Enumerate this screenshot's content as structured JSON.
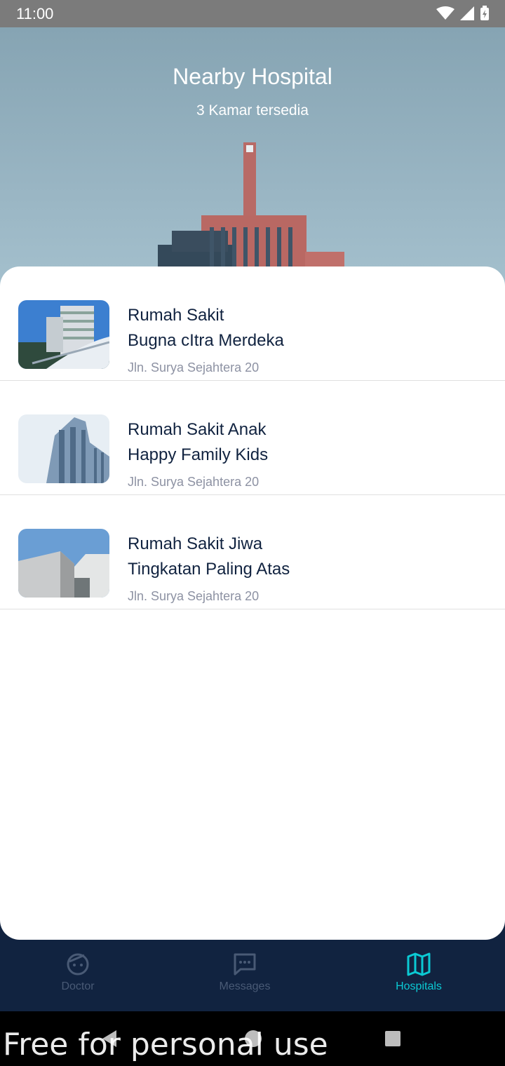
{
  "status_bar": {
    "time": "11:00"
  },
  "header": {
    "title": "Nearby Hospital",
    "subtitle": "3 Kamar tersedia"
  },
  "hospitals": [
    {
      "name": "Rumah Sakit\nBugna cItra Merdeka",
      "address": "Jln. Surya Sejahtera 20"
    },
    {
      "name": "Rumah Sakit Anak\nHappy Family Kids",
      "address": "Jln. Surya Sejahtera 20"
    },
    {
      "name": "Rumah Sakit Jiwa\nTingkatan Paling Atas",
      "address": "Jln. Surya Sejahtera 20"
    }
  ],
  "bottom_nav": {
    "items": [
      {
        "label": "Doctor",
        "icon": "doctor-face-icon",
        "active": false
      },
      {
        "label": "Messages",
        "icon": "message-icon",
        "active": false
      },
      {
        "label": "Hospitals",
        "icon": "map-icon",
        "active": true
      }
    ]
  },
  "colors": {
    "navy": "#112340",
    "accent": "#0bcad4",
    "inactive": "#495a75"
  },
  "watermark": "Free for personal use"
}
